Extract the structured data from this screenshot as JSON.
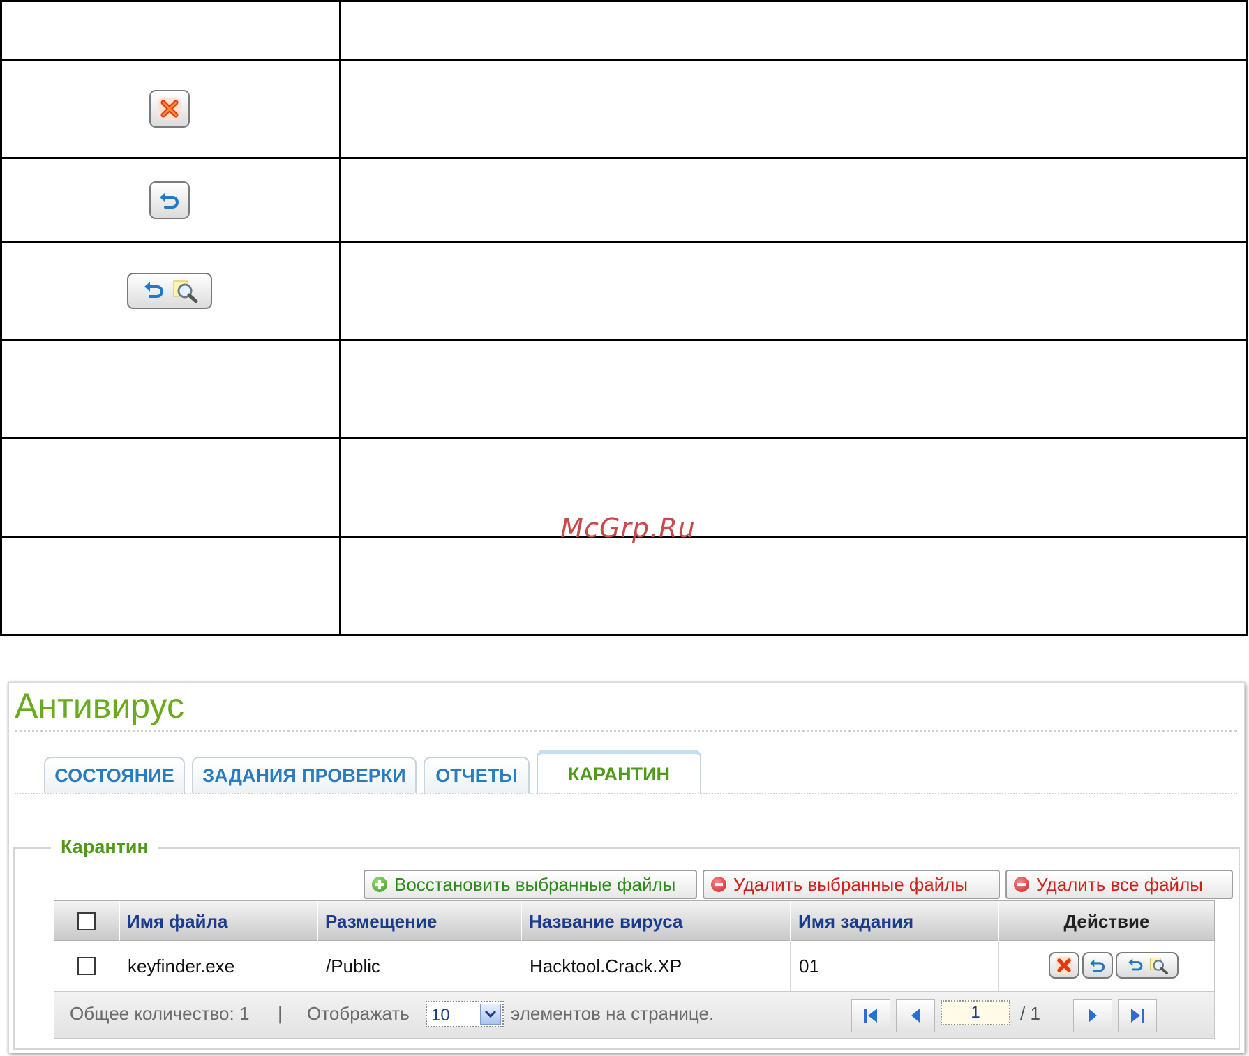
{
  "watermark": "McGrp.Ru",
  "app": {
    "title": "Антивирус",
    "tabs": [
      {
        "label": "СОСТОЯНИЕ",
        "active": false
      },
      {
        "label": "ЗАДАНИЯ ПРОВЕРКИ",
        "active": false
      },
      {
        "label": "ОТЧЕТЫ",
        "active": false
      },
      {
        "label": "КАРАНТИН",
        "active": true
      }
    ],
    "section_title": "Карантин",
    "actions": {
      "restore_selected": "Восстановить выбранные файлы",
      "delete_selected": "Удалить выбранные файлы",
      "delete_all": "Удалить все файлы"
    },
    "table": {
      "headers": [
        "Имя файла",
        "Размещение",
        "Название вируса",
        "Имя задания",
        "Действие"
      ],
      "rows": [
        {
          "file": "keyfinder.exe",
          "location": "/Public",
          "virus": "Hacktool.Crack.XP",
          "task": "01"
        }
      ]
    },
    "footer": {
      "total_label": "Общее количество: 1",
      "separator": "|",
      "show_label": "Отображать",
      "per_page_value": "10",
      "per_page_suffix": "элементов на странице.",
      "current_page": "1",
      "total_pages": "/ 1"
    }
  },
  "colors": {
    "brand_green": "#6aaa1e",
    "tab_blue": "#2a7cc0",
    "header_blue": "#1a3c8c",
    "delete_red": "#d0201c"
  }
}
